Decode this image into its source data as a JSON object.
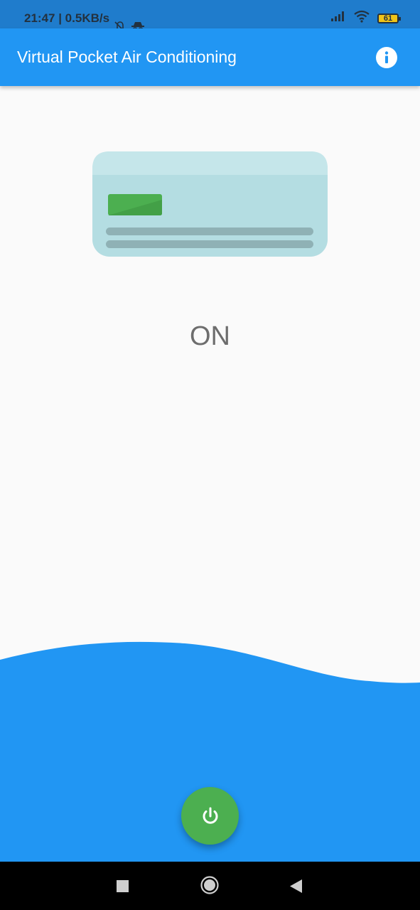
{
  "status_bar": {
    "time_speed": "21:47 | 0.5KB/s",
    "battery_level": "61",
    "icons": [
      "bell-off-icon",
      "incognito-icon",
      "signal-icon",
      "wifi-icon",
      "battery-icon"
    ]
  },
  "app_bar": {
    "title": "Virtual Pocket Air Conditioning",
    "info_icon": "info-icon"
  },
  "main": {
    "ac_state": "ON",
    "indicator_color": "#4caf50"
  },
  "colors": {
    "primary": "#2196f3",
    "accent": "#4caf50",
    "ac_body": "#b4dde2"
  },
  "nav_bar": {
    "buttons": [
      "recents-button",
      "home-button",
      "back-button"
    ]
  }
}
